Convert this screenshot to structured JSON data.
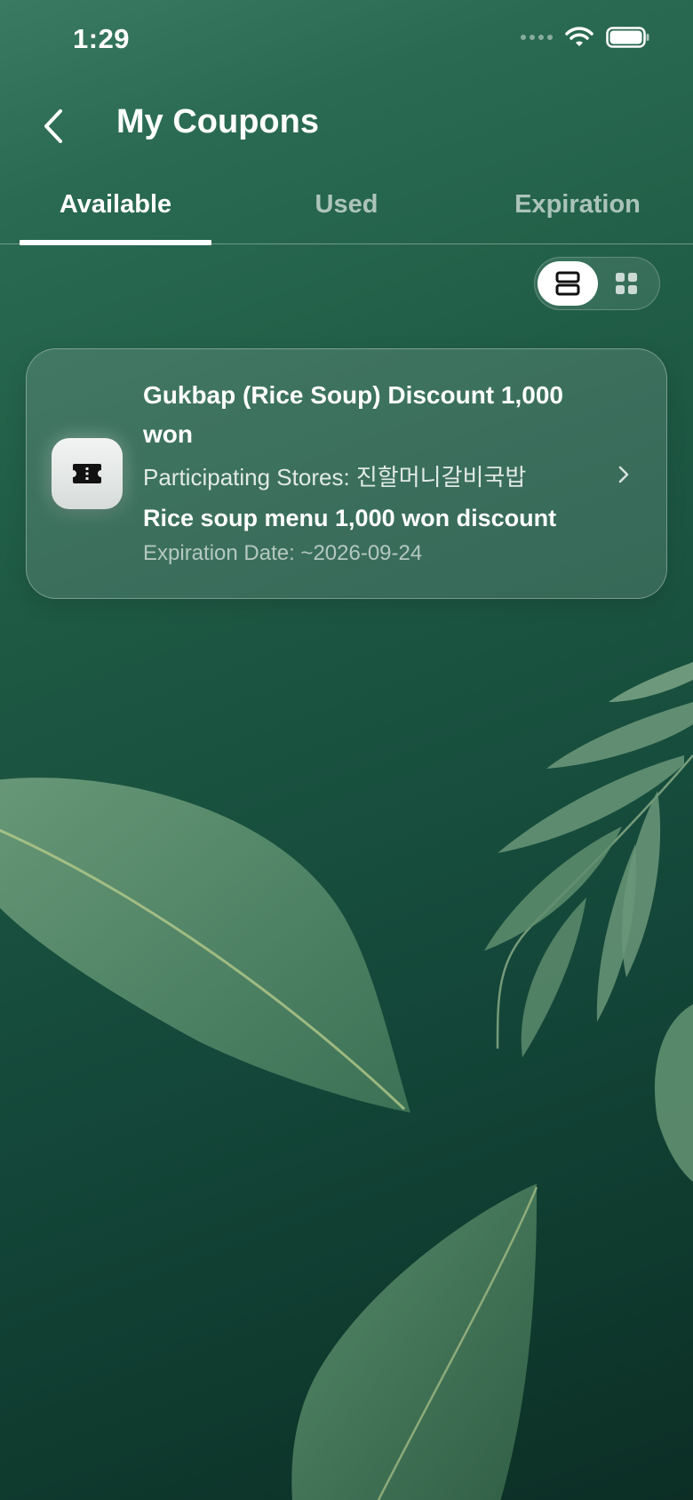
{
  "status_bar": {
    "time": "1:29",
    "icons": [
      "cellular-icon",
      "wifi-icon",
      "battery-icon"
    ]
  },
  "header": {
    "title": "My Coupons",
    "back_icon": "chevron-left-icon"
  },
  "tabs": [
    {
      "label": "Available",
      "active": true
    },
    {
      "label": "Used",
      "active": false
    },
    {
      "label": "Expiration",
      "active": false
    }
  ],
  "view_toggle": {
    "selected": "list",
    "options": [
      "list-view-icon",
      "grid-view-icon"
    ]
  },
  "coupons": [
    {
      "icon": "ticket-icon",
      "title": "Gukbap (Rice Soup) Discount 1,000 won",
      "stores": "Participating Stores: 진할머니갈비국밥",
      "description": "Rice soup menu 1,000 won discount",
      "expiration": "Expiration Date: ~2026-09-24"
    }
  ],
  "colors": {
    "background_top": "#3a7a62",
    "background_bottom": "#0c2e25",
    "text_primary": "#ffffff",
    "tab_inactive": "rgba(255,255,255,0.62)"
  }
}
